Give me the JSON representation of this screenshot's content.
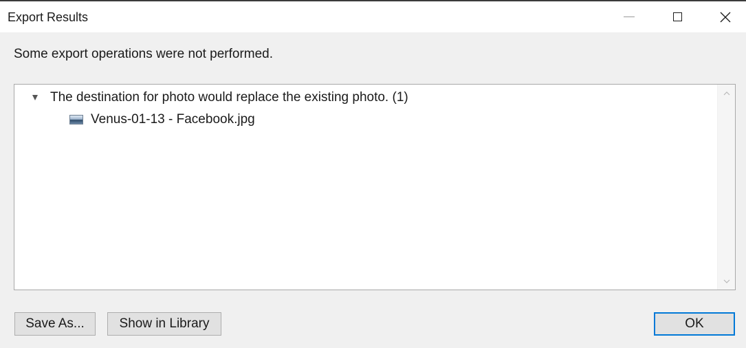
{
  "window": {
    "title": "Export Results"
  },
  "message": "Some export operations were not performed.",
  "results": {
    "group": {
      "label": "The destination for photo would replace the existing photo. (1)",
      "expanded": true,
      "icon": "expand-triangle-icon"
    },
    "items": [
      {
        "filename": "Venus-01-13 - Facebook.jpg",
        "icon": "photo-icon"
      }
    ]
  },
  "buttons": {
    "save_as": "Save As...",
    "show_in_library": "Show in Library",
    "ok": "OK"
  },
  "colors": {
    "background": "#f0f0f0",
    "titlebar": "#ffffff",
    "panel": "#ffffff",
    "button": "#e1e1e1",
    "default_button_border": "#0078d7"
  }
}
